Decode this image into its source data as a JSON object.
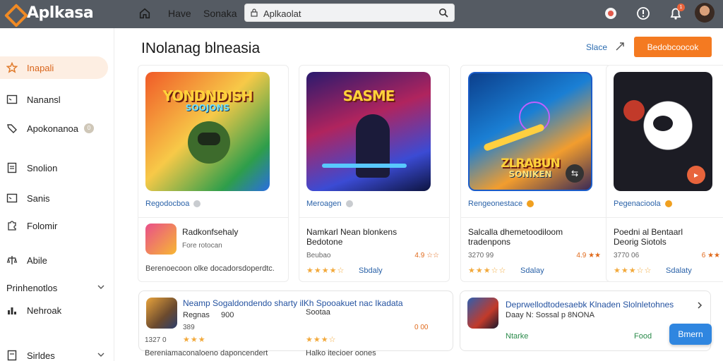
{
  "app": {
    "name": "Aplkasa"
  },
  "topbar": {
    "links": [
      "Have",
      "Sonaka"
    ],
    "search_value": "Aplkaolat",
    "notification_count": "1"
  },
  "sidebar": {
    "items": [
      {
        "label": "Inapali",
        "icon": "star-icon",
        "active": true
      },
      {
        "label": "Nanansl",
        "icon": "window-icon"
      },
      {
        "label": "Apokonanoa",
        "icon": "tag-icon",
        "count": "0"
      },
      {
        "label": "Snolion",
        "icon": "doc-icon"
      },
      {
        "label": "Sanis",
        "icon": "window-icon"
      },
      {
        "label": "Folomir",
        "icon": "puzzle-icon"
      },
      {
        "label": "Abile",
        "icon": "scale-icon"
      },
      {
        "label": "Prinhenotlos",
        "icon": "none",
        "expand": true
      },
      {
        "label": "Nehroak",
        "icon": "chart-icon"
      },
      {
        "label": "Sirldes",
        "icon": "doc-icon",
        "expand": true
      }
    ]
  },
  "main": {
    "title": "INolanag blneasia",
    "header_link": "Slace",
    "cta_label": "Bedobcoocok"
  },
  "cards": [
    {
      "art_title": "YONDNDISH",
      "art_subtitle": "SOOJONS",
      "category": "Regodocboa",
      "name": "Radkonfsehaly",
      "meta": "Fore rotocan",
      "stars": "★★★★☆",
      "stars_text": "",
      "desc": "Berenoecoon olke docadorsdoperdtc.",
      "accent": "#9aa3ad"
    },
    {
      "art_title": "SASME",
      "art_subtitle": "",
      "category": "Meroagen",
      "name": "Namkarl Nean blonkens\nBedotone",
      "meta": "Beubao",
      "meta_right": "4.9 ☆☆",
      "stars": "★★★★☆",
      "stars_text": "Sbdaly",
      "accent": "#9aa3ad"
    },
    {
      "art_title": "ZLRABUN",
      "art_subtitle": "SONIKEN",
      "category": "Rengeonestace",
      "name": "Salcalla dhemetoodiloom\ntradenpons",
      "meta": "3270 99",
      "meta_right": "4.9 ★★",
      "stars": "★★★☆☆",
      "stars_text": "Sdalay",
      "accent": "#f0a020"
    },
    {
      "art_title": "",
      "art_subtitle": "",
      "category": "Pegenacioola",
      "name": "Poedni al Bentaarl\nDeorig Siotols",
      "meta": "3770 06",
      "meta_right": "6 ★★",
      "stars": "★★★☆☆",
      "stars_text": "Sdalaty",
      "accent": "#f0a020"
    }
  ],
  "bottom": {
    "left": {
      "title": "Neamp Sogaldondendo sharty ilKh Spooakuet nac Ikadata",
      "subtitle": "Regnas",
      "subtitle2": "900",
      "subtitle3": "Sootaa",
      "meta1": "389",
      "meta2": "0 00",
      "rating": "1327 0",
      "stars1": "★★★",
      "stars2": "★★★☆",
      "desc1": "Bereniamaconaloeno daponcendert",
      "desc2": "Halko itecioer oones"
    },
    "right": {
      "title": "Deprwellodtodesaebk Klnaden Slolnletohnes",
      "subtitle": "Daay N: Sossal p 8NONA",
      "foot1": "Ntarke",
      "foot2": "Food",
      "button": "Bmern"
    }
  }
}
